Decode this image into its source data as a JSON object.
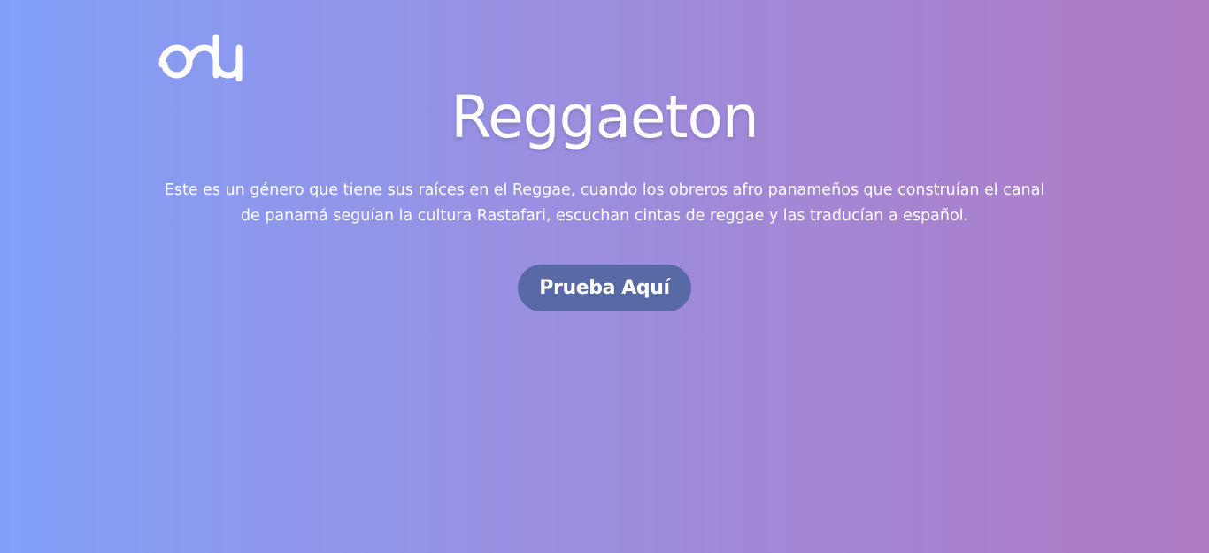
{
  "logo": {
    "icon": "brand-logo-icon"
  },
  "hero": {
    "title": "Reggaeton",
    "description": "Este es un género que tiene sus raíces en el Reggae, cuando los obreros afro panameños que construían el canal de panamá seguían la cultura Rastafari, escuchan cintas de reggae y las traducían a español.",
    "cta_label": "Prueba Aquí"
  },
  "colors": {
    "gradient_left": "#80a0f8",
    "gradient_right": "#b07ac4",
    "button_bg": "#586aa6",
    "text": "#ffffff"
  }
}
